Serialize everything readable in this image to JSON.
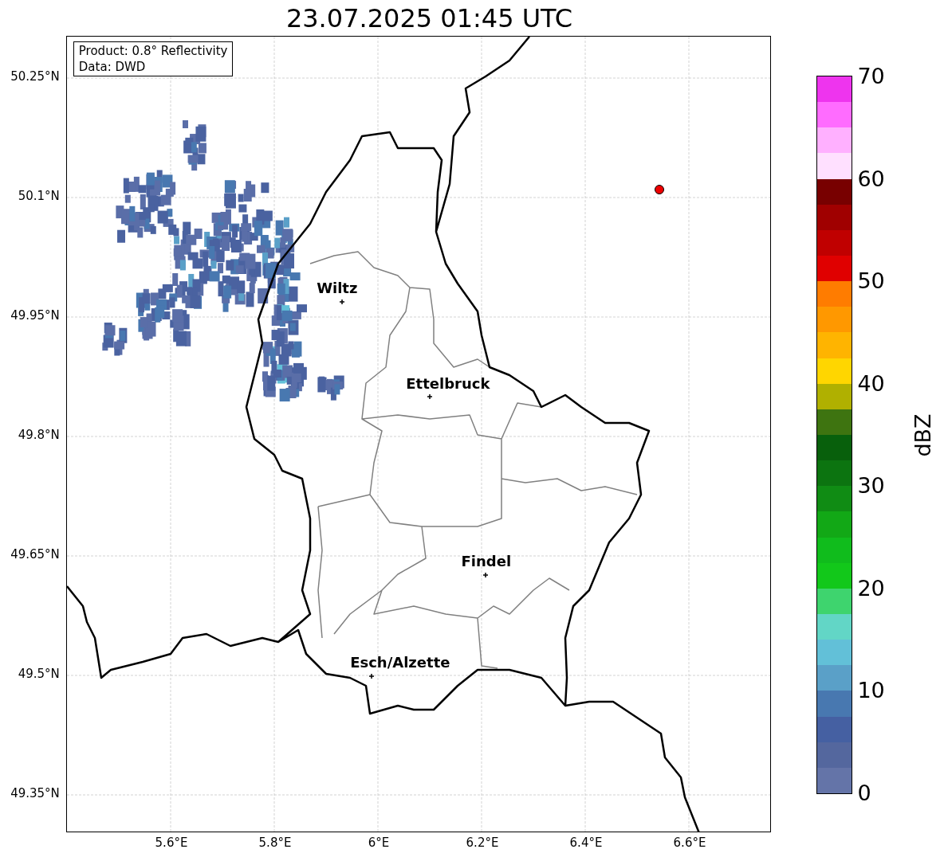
{
  "title": "23.07.2025 01:45 UTC",
  "legend": {
    "lines": [
      "Product: 0.8° Reflectivity",
      "Data: DWD"
    ]
  },
  "y_ticks": [
    "50.25°N",
    "50.1°N",
    "49.95°N",
    "49.8°N",
    "49.65°N",
    "49.5°N",
    "49.35°N"
  ],
  "x_ticks": [
    "5.6°E",
    "5.8°E",
    "6°E",
    "6.2°E",
    "6.4°E",
    "6.6°E"
  ],
  "cities": [
    {
      "name": "Wiltz"
    },
    {
      "name": "Ettelbruck"
    },
    {
      "name": "Findel"
    },
    {
      "name": "Esch/Alzette"
    }
  ],
  "colorbar": {
    "label": "dBZ",
    "ticks": [
      "70",
      "60",
      "50",
      "40",
      "30",
      "20",
      "10",
      "0"
    ],
    "segments": [
      {
        "color": "#ee34ee"
      },
      {
        "color": "#ff6cff"
      },
      {
        "color": "#ffb0ff"
      },
      {
        "color": "#ffe0ff"
      },
      {
        "color": "#780000"
      },
      {
        "color": "#a00000"
      },
      {
        "color": "#c00000"
      },
      {
        "color": "#e00000"
      },
      {
        "color": "#ff7c00"
      },
      {
        "color": "#ff9800"
      },
      {
        "color": "#ffb400"
      },
      {
        "color": "#ffd600"
      },
      {
        "color": "#b0b000"
      },
      {
        "color": "#3e7410"
      },
      {
        "color": "#08600c"
      },
      {
        "color": "#0c7410"
      },
      {
        "color": "#108c14"
      },
      {
        "color": "#12a816"
      },
      {
        "color": "#10bc1c"
      },
      {
        "color": "#12c81a"
      },
      {
        "color": "#3ed46e"
      },
      {
        "color": "#62d6c6"
      },
      {
        "color": "#62c0d8"
      },
      {
        "color": "#5aa0c8"
      },
      {
        "color": "#4878b0"
      },
      {
        "color": "#4560a2"
      },
      {
        "color": "#54679e"
      },
      {
        "color": "#6474a8"
      }
    ]
  }
}
